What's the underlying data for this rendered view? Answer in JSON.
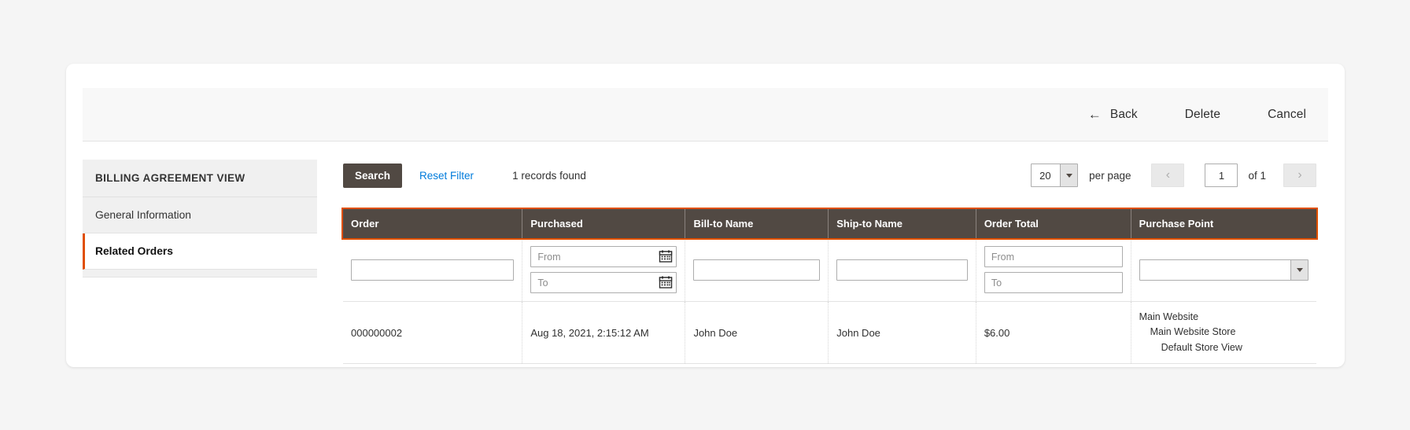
{
  "header": {
    "back_label": "Back",
    "back_icon": "arrow-left-icon",
    "delete_label": "Delete",
    "cancel_label": "Cancel"
  },
  "sidebar": {
    "title": "BILLING AGREEMENT VIEW",
    "items": [
      {
        "label": "General Information",
        "active": false
      },
      {
        "label": "Related Orders",
        "active": true
      }
    ],
    "active_accent": "#e04f00"
  },
  "toolbar": {
    "search_label": "Search",
    "reset_label": "Reset Filter",
    "records_found": "1 records found",
    "per_page_value": "20",
    "per_page_label": "per page",
    "prev_icon": "chevron-left-icon",
    "next_icon": "chevron-right-icon",
    "page_value": "1",
    "page_of": "of 1"
  },
  "grid": {
    "columns": [
      "Order",
      "Purchased",
      "Bill-to Name",
      "Ship-to Name",
      "Order Total",
      "Purchase Point"
    ],
    "filters": {
      "order": "",
      "purchased_from": "From",
      "purchased_to": "To",
      "bill_to_name": "",
      "ship_to_name": "",
      "total_from": "From",
      "total_to": "To",
      "purchase_point": "",
      "calendar_icon": "calendar-icon",
      "dropdown_icon": "chevron-down-icon"
    },
    "rows": [
      {
        "order": "000000002",
        "purchased": "Aug 18, 2021, 2:15:12 AM",
        "bill_to_name": "John Doe",
        "ship_to_name": "John Doe",
        "order_total": "$6.00",
        "purchase_point_1": "Main Website",
        "purchase_point_2": "Main Website Store",
        "purchase_point_3": "Default Store View"
      }
    ]
  },
  "colors": {
    "header_bg": "#514943",
    "accent": "#e04f00",
    "link": "#007bdb"
  }
}
